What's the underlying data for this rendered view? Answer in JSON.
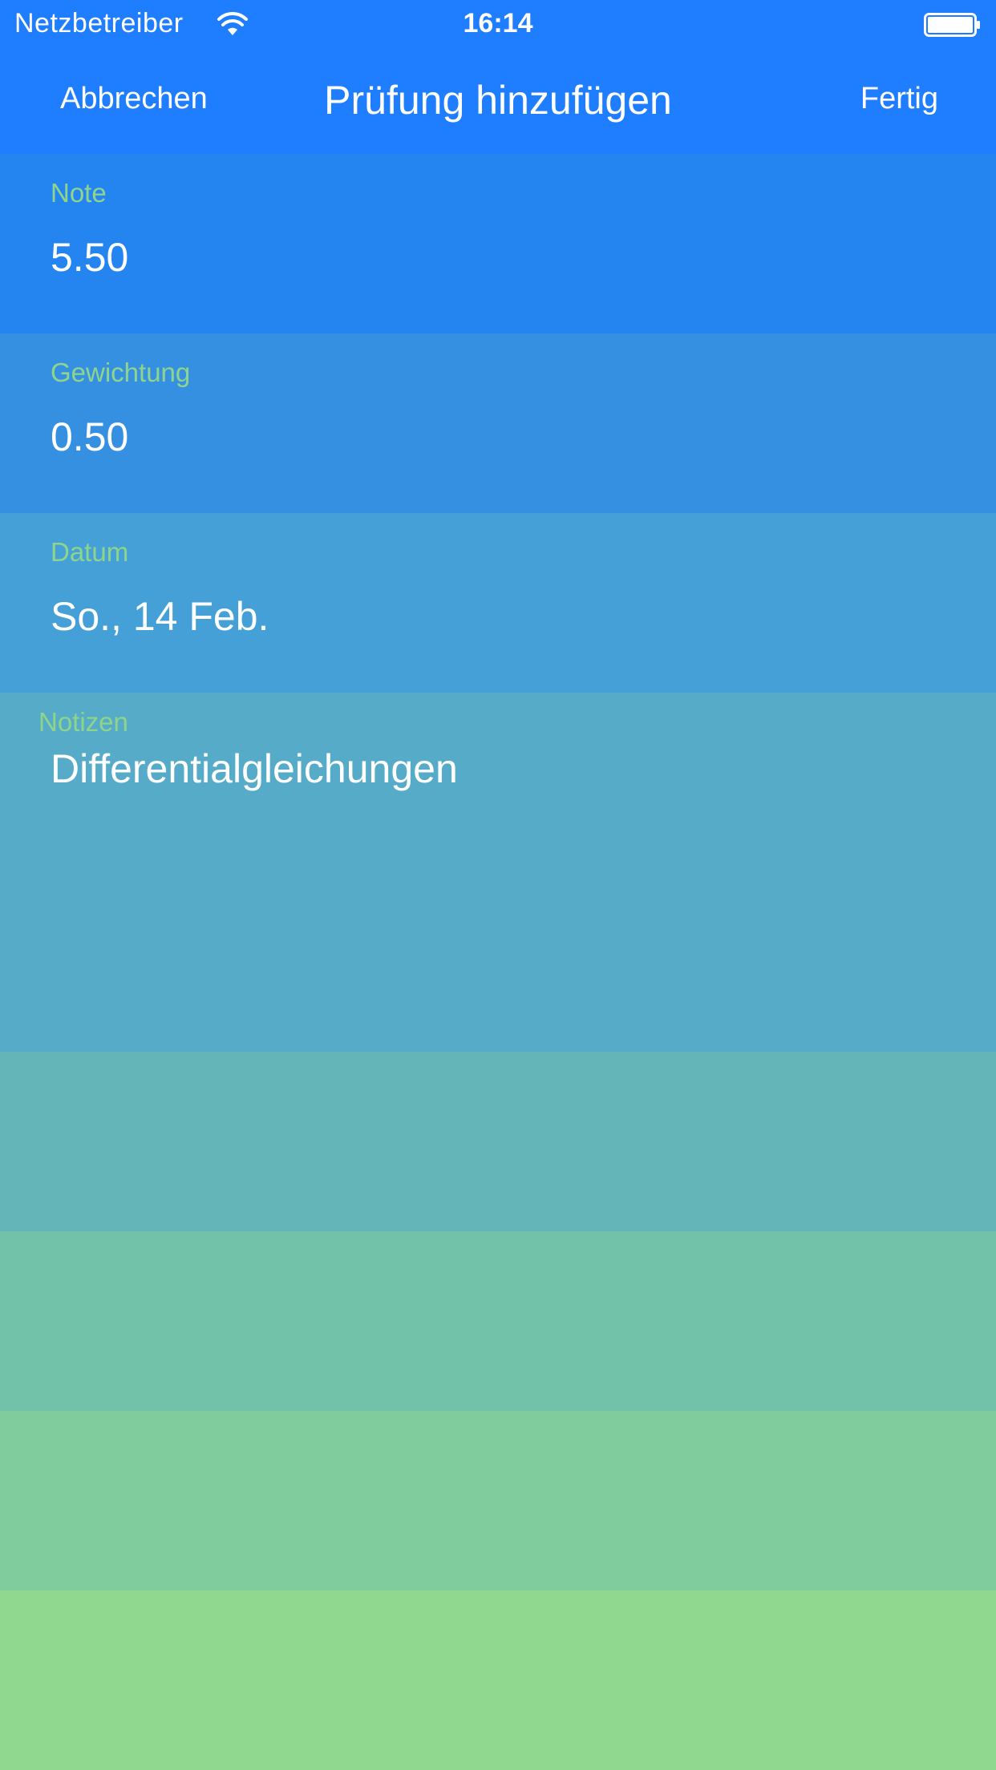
{
  "status_bar": {
    "carrier": "Netzbetreiber",
    "time": "16:14",
    "wifi_icon": "wifi-icon",
    "battery_icon": "battery-full-icon"
  },
  "nav": {
    "cancel_label": "Abbrechen",
    "title": "Prüfung hinzufügen",
    "done_label": "Fertig"
  },
  "form": {
    "grade": {
      "label": "Note",
      "value": "5.50"
    },
    "weight": {
      "label": "Gewichtung",
      "value": "0.50"
    },
    "date": {
      "label": "Datum",
      "value": "So., 14 Feb."
    },
    "notes": {
      "label": "Notizen",
      "value": "Differentialgleichungen"
    }
  },
  "colors": {
    "nav_background": "#1e7eff",
    "label_green": "#8fd48c",
    "row_gradient": [
      "#2585f0",
      "#3690e2",
      "#45a0d8",
      "#55abc8",
      "#63b5b8",
      "#72c1a9",
      "#80cc9c",
      "#90d890"
    ]
  }
}
